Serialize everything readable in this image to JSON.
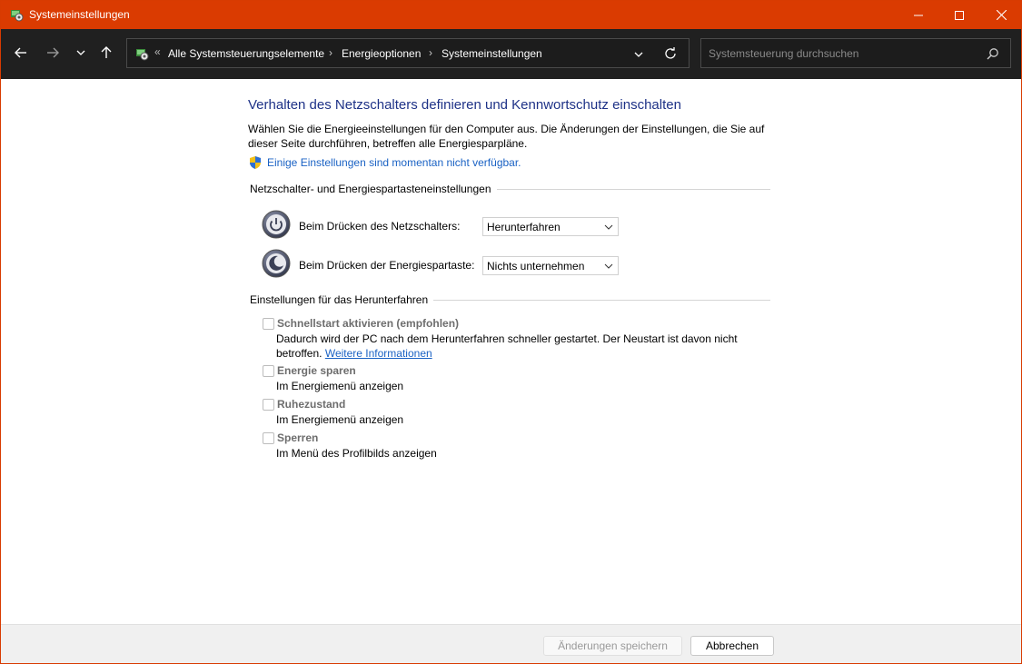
{
  "window": {
    "title": "Systemeinstellungen",
    "accent_color": "#da3b01"
  },
  "nav": {
    "back_icon": "arrow-left-icon",
    "forward_icon": "arrow-right-icon",
    "recent_icon": "chevron-down-icon",
    "up_icon": "arrow-up-icon"
  },
  "address": {
    "overflow": "«",
    "crumbs": [
      "Alle Systemsteuerungselemente",
      "Energieoptionen",
      "Systemeinstellungen"
    ],
    "separator": "›"
  },
  "search": {
    "placeholder": "Systemsteuerung durchsuchen"
  },
  "main": {
    "heading": "Verhalten des Netzschalters definieren und Kennwortschutz einschalten",
    "description": "Wählen Sie die Energieeinstellungen für den Computer aus. Die Änderungen der Einstellungen, die Sie auf dieser Seite durchführen, betreffen alle Energiesparpläne.",
    "unavailable_link": "Einige Einstellungen sind momentan nicht verfügbar.",
    "power_group_title": "Netzschalter- und Energiespartasteneinstellungen",
    "power_button_label": "Beim Drücken des Netzschalters:",
    "power_button_value": "Herunterfahren",
    "sleep_button_label": "Beim Drücken der Energiespartaste:",
    "sleep_button_value": "Nichts unternehmen",
    "shutdown_group_title": "Einstellungen für das Herunterfahren",
    "options": [
      {
        "label": "Schnellstart aktivieren (empfohlen)",
        "desc": "Dadurch wird der PC nach dem Herunterfahren schneller gestartet. Der Neustart ist davon nicht betroffen.",
        "link": "Weitere Informationen",
        "checked": false
      },
      {
        "label": "Energie sparen",
        "desc": "Im Energiemenü anzeigen",
        "checked": false
      },
      {
        "label": "Ruhezustand",
        "desc": "Im Energiemenü anzeigen",
        "checked": false
      },
      {
        "label": "Sperren",
        "desc": "Im Menü des Profilbilds anzeigen",
        "checked": false
      }
    ]
  },
  "footer": {
    "save_label": "Änderungen speichern",
    "cancel_label": "Abbrechen"
  }
}
